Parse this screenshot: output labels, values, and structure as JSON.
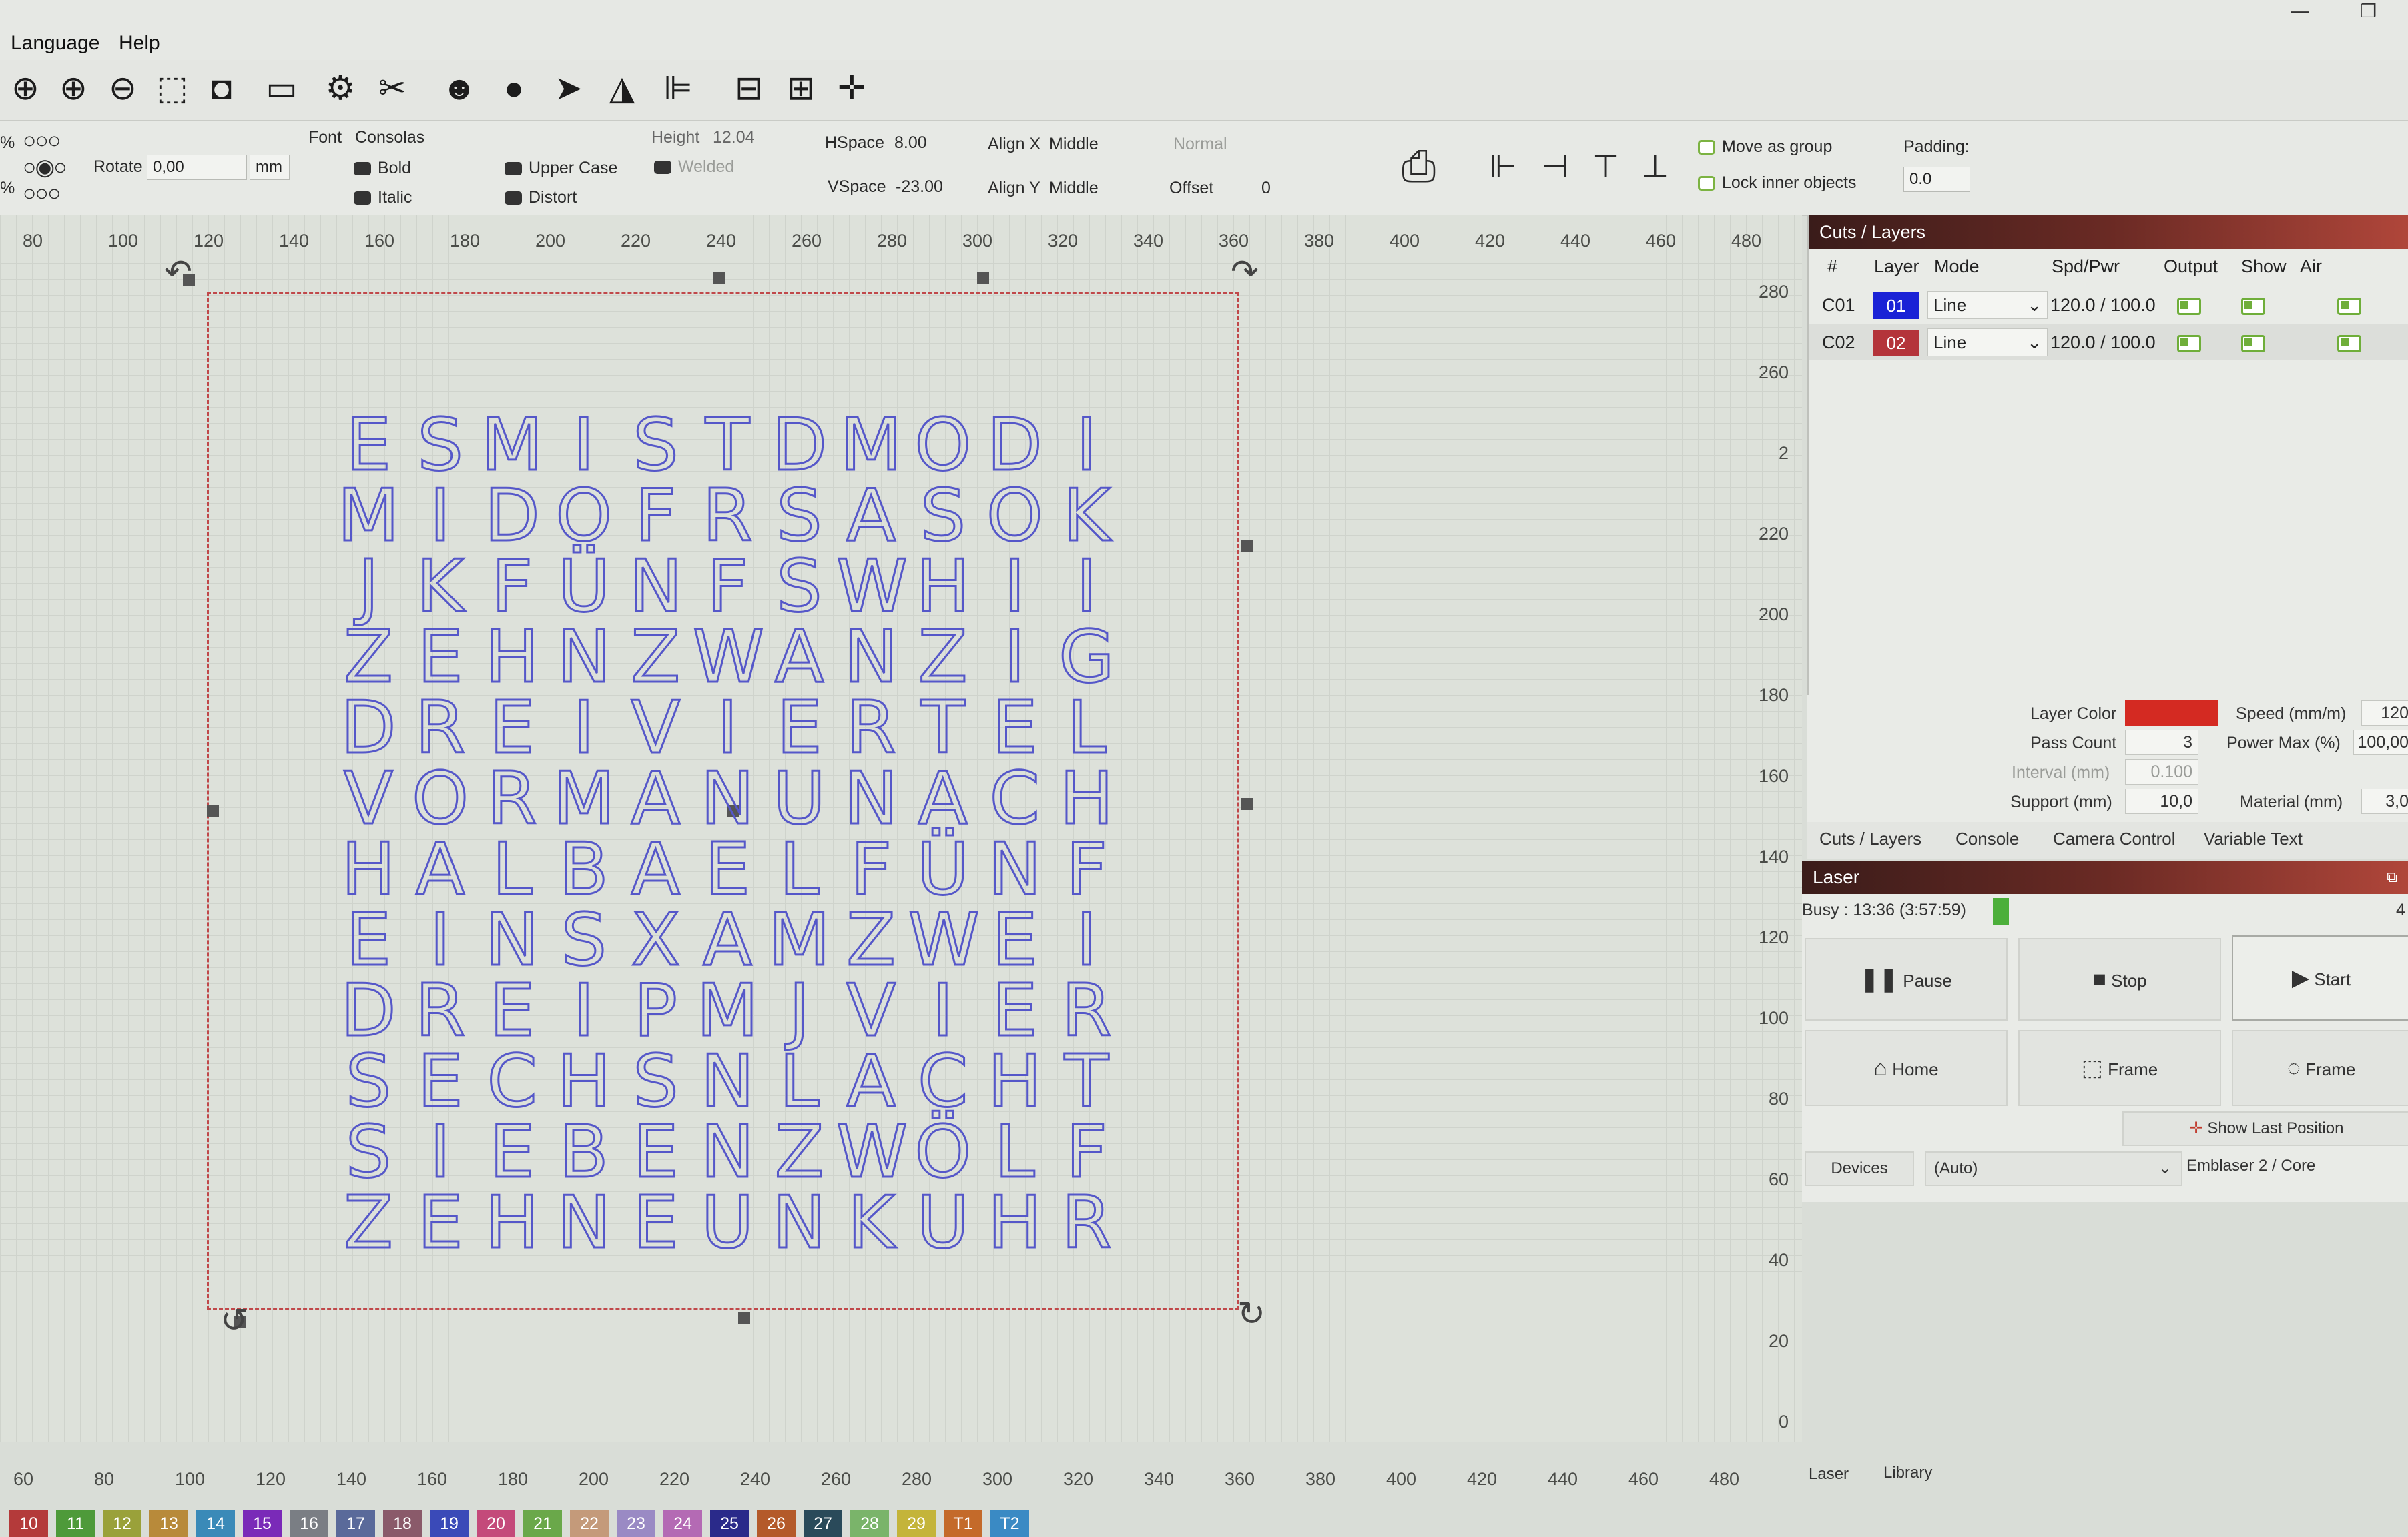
{
  "menu": {
    "language": "Language",
    "help": "Help"
  },
  "toolbar": {
    "icons": [
      "zoom-fit-icon",
      "zoom-in-icon",
      "zoom-out-icon",
      "select-rect-icon",
      "camera-icon",
      "monitor-icon",
      "settings-icon",
      "tools-icon",
      "users-icon",
      "user-icon",
      "send-icon",
      "mirror-icon",
      "align-left-icon",
      "distribute-h-icon",
      "distribute-v-icon",
      "center-icon"
    ]
  },
  "options": {
    "rotate_label": "Rotate",
    "rotate_value": "0,00",
    "unit": "mm",
    "font_label": "Font",
    "font_value": "Consolas",
    "height_label": "Height",
    "height_value": "12.04",
    "hspace_label": "HSpace",
    "hspace_value": "8.00",
    "vspace_label": "VSpace",
    "vspace_value": "-23.00",
    "alignx_label": "Align X",
    "alignx_value": "Middle",
    "aligny_label": "Align Y",
    "aligny_value": "Middle",
    "normal_value": "Normal",
    "offset_label": "Offset",
    "offset_value": "0",
    "bold": "Bold",
    "italic": "Italic",
    "upper_case": "Upper Case",
    "distort": "Distort",
    "welded": "Welded",
    "move_as_group": "Move as group",
    "lock_inner": "Lock inner objects",
    "padding_label": "Padding:",
    "padding_value": "0.0",
    "pct1": "%",
    "pct2": "%"
  },
  "ruler_top": [
    "80",
    "100",
    "120",
    "140",
    "160",
    "180",
    "200",
    "220",
    "240",
    "260",
    "280",
    "300",
    "320",
    "340",
    "360",
    "380",
    "400",
    "420",
    "440",
    "460",
    "480"
  ],
  "ruler_right": [
    "280",
    "260",
    "2",
    "220",
    "200",
    "180",
    "160",
    "140",
    "120",
    "100",
    "80",
    "60",
    "40",
    "20",
    "0"
  ],
  "ruler_bottom": [
    "60",
    "80",
    "100",
    "120",
    "140",
    "160",
    "180",
    "200",
    "220",
    "240",
    "260",
    "280",
    "300",
    "320",
    "340",
    "360",
    "380",
    "400",
    "420",
    "440",
    "460",
    "480"
  ],
  "letter_grid": [
    "ESMISTDMODI",
    "MIDOFRSASOK",
    "JKFÜNFSWHII",
    "ZEHNZWANZIG",
    "DREIVIERTEL",
    "VORMANUNACH",
    "HALBAELFÜNF",
    "EINSXAMZWEI",
    "DREIPMJVIER",
    "SECHSNLACHT",
    "SIEBENZWÖLF",
    "ZEHNEUNKUHR"
  ],
  "cuts": {
    "title": "Cuts / Layers",
    "headers": {
      "num": "#",
      "layer": "Layer",
      "mode": "Mode",
      "spdpwr": "Spd/Pwr",
      "output": "Output",
      "show": "Show",
      "air": "Air"
    },
    "rows": [
      {
        "id": "C01",
        "layer": "01",
        "color": "#1a22d6",
        "mode": "Line",
        "spdpwr": "120.0 / 100.0"
      },
      {
        "id": "C02",
        "layer": "02",
        "color": "#b4343a",
        "mode": "Line",
        "spdpwr": "120.0 / 100.0"
      }
    ]
  },
  "layer_props": {
    "layer_color_label": "Layer Color",
    "layer_color": "#d42a22",
    "speed_label": "Speed (mm/m)",
    "speed_value": "120",
    "pass_count_label": "Pass Count",
    "pass_count_value": "3",
    "power_max_label": "Power Max (%)",
    "power_max_value": "100,00",
    "interval_label": "Interval (mm)",
    "interval_value": "0.100",
    "support_label": "Support (mm)",
    "support_value": "10,0",
    "material_label": "Material (mm)",
    "material_value": "3,0"
  },
  "tabs_a": [
    "Cuts / Layers",
    "Console",
    "Camera Control",
    "Variable Text"
  ],
  "laser": {
    "title": "Laser",
    "status": "Busy : 13:36 (3:57:59)",
    "status_right": "4",
    "pause": "Pause",
    "stop": "Stop",
    "start": "Start",
    "home": "Home",
    "frame1": "Frame",
    "frame2": "Frame",
    "show_last": "Show Last Position",
    "devices": "Devices",
    "port": "(Auto)",
    "device": "Emblaser 2 / Core"
  },
  "bottom_tabs": [
    "Laser",
    "Library"
  ],
  "palette": [
    {
      "label": "10",
      "color": "#b43a3a"
    },
    {
      "label": "11",
      "color": "#4e9a3a"
    },
    {
      "label": "12",
      "color": "#9aa13a"
    },
    {
      "label": "13",
      "color": "#b88a3a"
    },
    {
      "label": "14",
      "color": "#3a8ab8"
    },
    {
      "label": "15",
      "color": "#7a2ab8"
    },
    {
      "label": "16",
      "color": "#7a7e84"
    },
    {
      "label": "17",
      "color": "#5a6a9a"
    },
    {
      "label": "18",
      "color": "#8a5a6a"
    },
    {
      "label": "19",
      "color": "#3a4ab8"
    },
    {
      "label": "20",
      "color": "#c44a7a"
    },
    {
      "label": "21",
      "color": "#6aa84a"
    },
    {
      "label": "22",
      "color": "#c49a7a"
    },
    {
      "label": "23",
      "color": "#9a8ac4"
    },
    {
      "label": "24",
      "color": "#b46ab4"
    },
    {
      "label": "25",
      "color": "#2a2a8a"
    },
    {
      "label": "26",
      "color": "#b45a2a"
    },
    {
      "label": "27",
      "color": "#2a4a5a"
    },
    {
      "label": "28",
      "color": "#7ab46a"
    },
    {
      "label": "29",
      "color": "#c4b43a"
    },
    {
      "label": "T1",
      "color": "#c46a2a"
    },
    {
      "label": "T2",
      "color": "#3a8ac4"
    }
  ]
}
